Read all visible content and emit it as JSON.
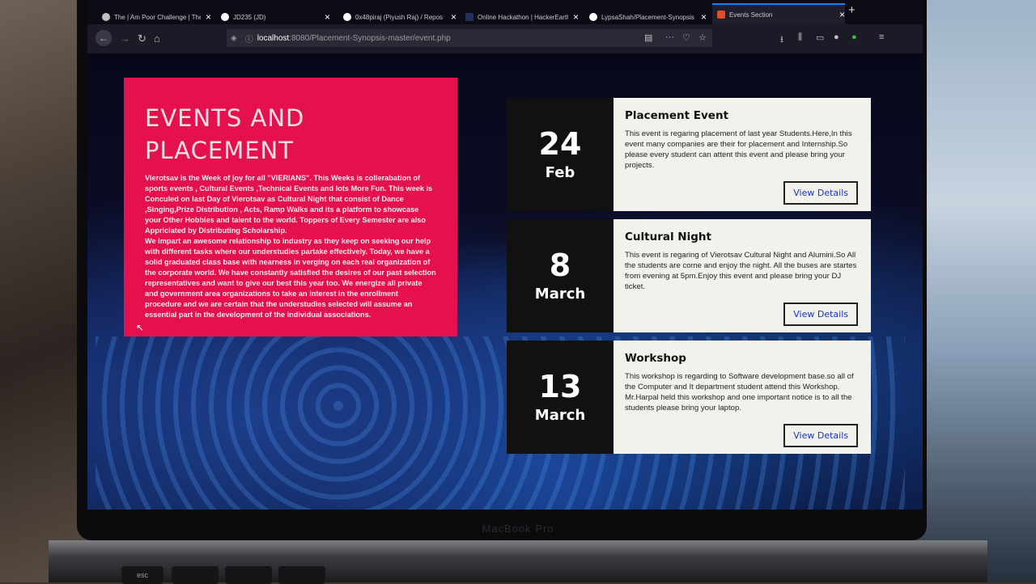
{
  "device_label": "MacBook Pro",
  "keyboard": {
    "esc": "esc"
  },
  "browser": {
    "tabs": [
      {
        "title": "The | Am Poor Challenge | The",
        "favicon_color": "#c0c0c0"
      },
      {
        "title": "JD235 (JD)",
        "favicon_color": "#ffffff"
      },
      {
        "title": "0x48piraj (Piyush Raj) / Repos",
        "favicon_color": "#ffffff"
      },
      {
        "title": "Online Hackathon | HackerEarth",
        "favicon_color": "#23305e"
      },
      {
        "title": "LypsaShah/Placement-Synopsis",
        "favicon_color": "#ffffff"
      },
      {
        "title": "Events Section",
        "favicon_color": "#e24b2a",
        "active": true
      }
    ],
    "new_tab": "+",
    "url": {
      "host": "localhost",
      "path": ":8080/Placement-Synopsis-master/event.php"
    }
  },
  "hero": {
    "title_line1": "EVENTS AND",
    "title_line2": "PLACEMENT",
    "paragraph1": "Vierotsav is the Week of joy for all \"VIERIANS\". This Weeks is collerabation of sports events , Cultural Events ,Technical Events and lots More Fun. This week is Conculed on last Day of Vierotsav as Cultural Night that consist of Dance ,Singing,Prize Distribution , Acts, Ramp Walks and its a platform to showcase your Other Hobbies and talent to the world. Toppers of Every Semester are also Appriciated by Distributing Scholarship.",
    "paragraph2": "We impart an awesome relationship to industry as they keep on seeking our help with different tasks where our understudies partake effectively. Today, we have a solid graduated class base with nearness in verging on each real organization of the corporate world. We have constantly satisfied the desires of our past selection representatives and want to give our best this year too. We energize all private and government area organizations to take an interest in the enrollment procedure and we are certain that the understudies selected will assume an essential part in the development of the individual associations.",
    "color": "#e5114f"
  },
  "events": [
    {
      "day": "24",
      "month": "Feb",
      "title": "Placement Event",
      "description": "This event is regaring placement of last year Students.Here,In this event many companies are their for placement and Internship.So please every student can attent this event and please bring your projects.",
      "button": "View Details"
    },
    {
      "day": "8",
      "month": "March",
      "title": "Cultural Night",
      "description": "This event is regaring of Vierotsav Cultural Night and Alumini.So All the students are come and enjoy the night. All the buses are startes from evening at 5pm.Enjoy this event and please bring your DJ ticket.",
      "button": "View Details"
    },
    {
      "day": "13",
      "month": "March",
      "title": "Workshop",
      "description": "This workshop is regarding to Software development base.so all of the Computer and It department student attend this Workshop. Mr.Harpal held this workshop and one important notice is to all the students please bring your laptop.",
      "button": "View Details"
    }
  ]
}
